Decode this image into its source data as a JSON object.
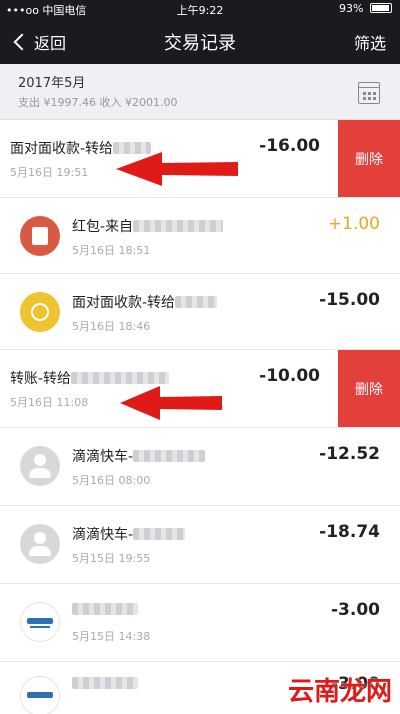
{
  "status_bar": {
    "carrier": "•••oo 中国电信",
    "time": "上午9:22",
    "battery": "93%"
  },
  "nav": {
    "back_label": "返回",
    "title": "交易记录",
    "filter_label": "筛选"
  },
  "month_header": {
    "month": "2017年5月",
    "summary": "支出 ¥1997.46 收入 ¥2001.00"
  },
  "rows": [
    {
      "title": "面对面收款-转给",
      "date": "5月16日 19:51",
      "amount": "-16.00",
      "delete_label": "删除"
    },
    {
      "title": "红包-来自",
      "date": "5月16日 18:51",
      "amount": "+1.00"
    },
    {
      "title": "面对面收款-转给",
      "date": "5月16日 18:46",
      "amount": "-15.00"
    },
    {
      "title": "转账-转给",
      "date": "5月16日 11:08",
      "amount": "-10.00",
      "delete_label": "删除"
    },
    {
      "title": "滴滴快车-",
      "date": "5月16日 08:00",
      "amount": "-12.52"
    },
    {
      "title": "滴滴快车-",
      "date": "5月15日 19:55",
      "amount": "-18.74"
    },
    {
      "title": "",
      "date": "5月15日 14:38",
      "amount": "-3.00"
    },
    {
      "title": "",
      "date": "",
      "amount": "-3.00"
    }
  ],
  "colors": {
    "nav_bg": "#1b1a1f",
    "delete_bg": "#e3403c",
    "income": "#e8a91c",
    "arrow": "#e01a17"
  },
  "watermark": "云南龙网"
}
